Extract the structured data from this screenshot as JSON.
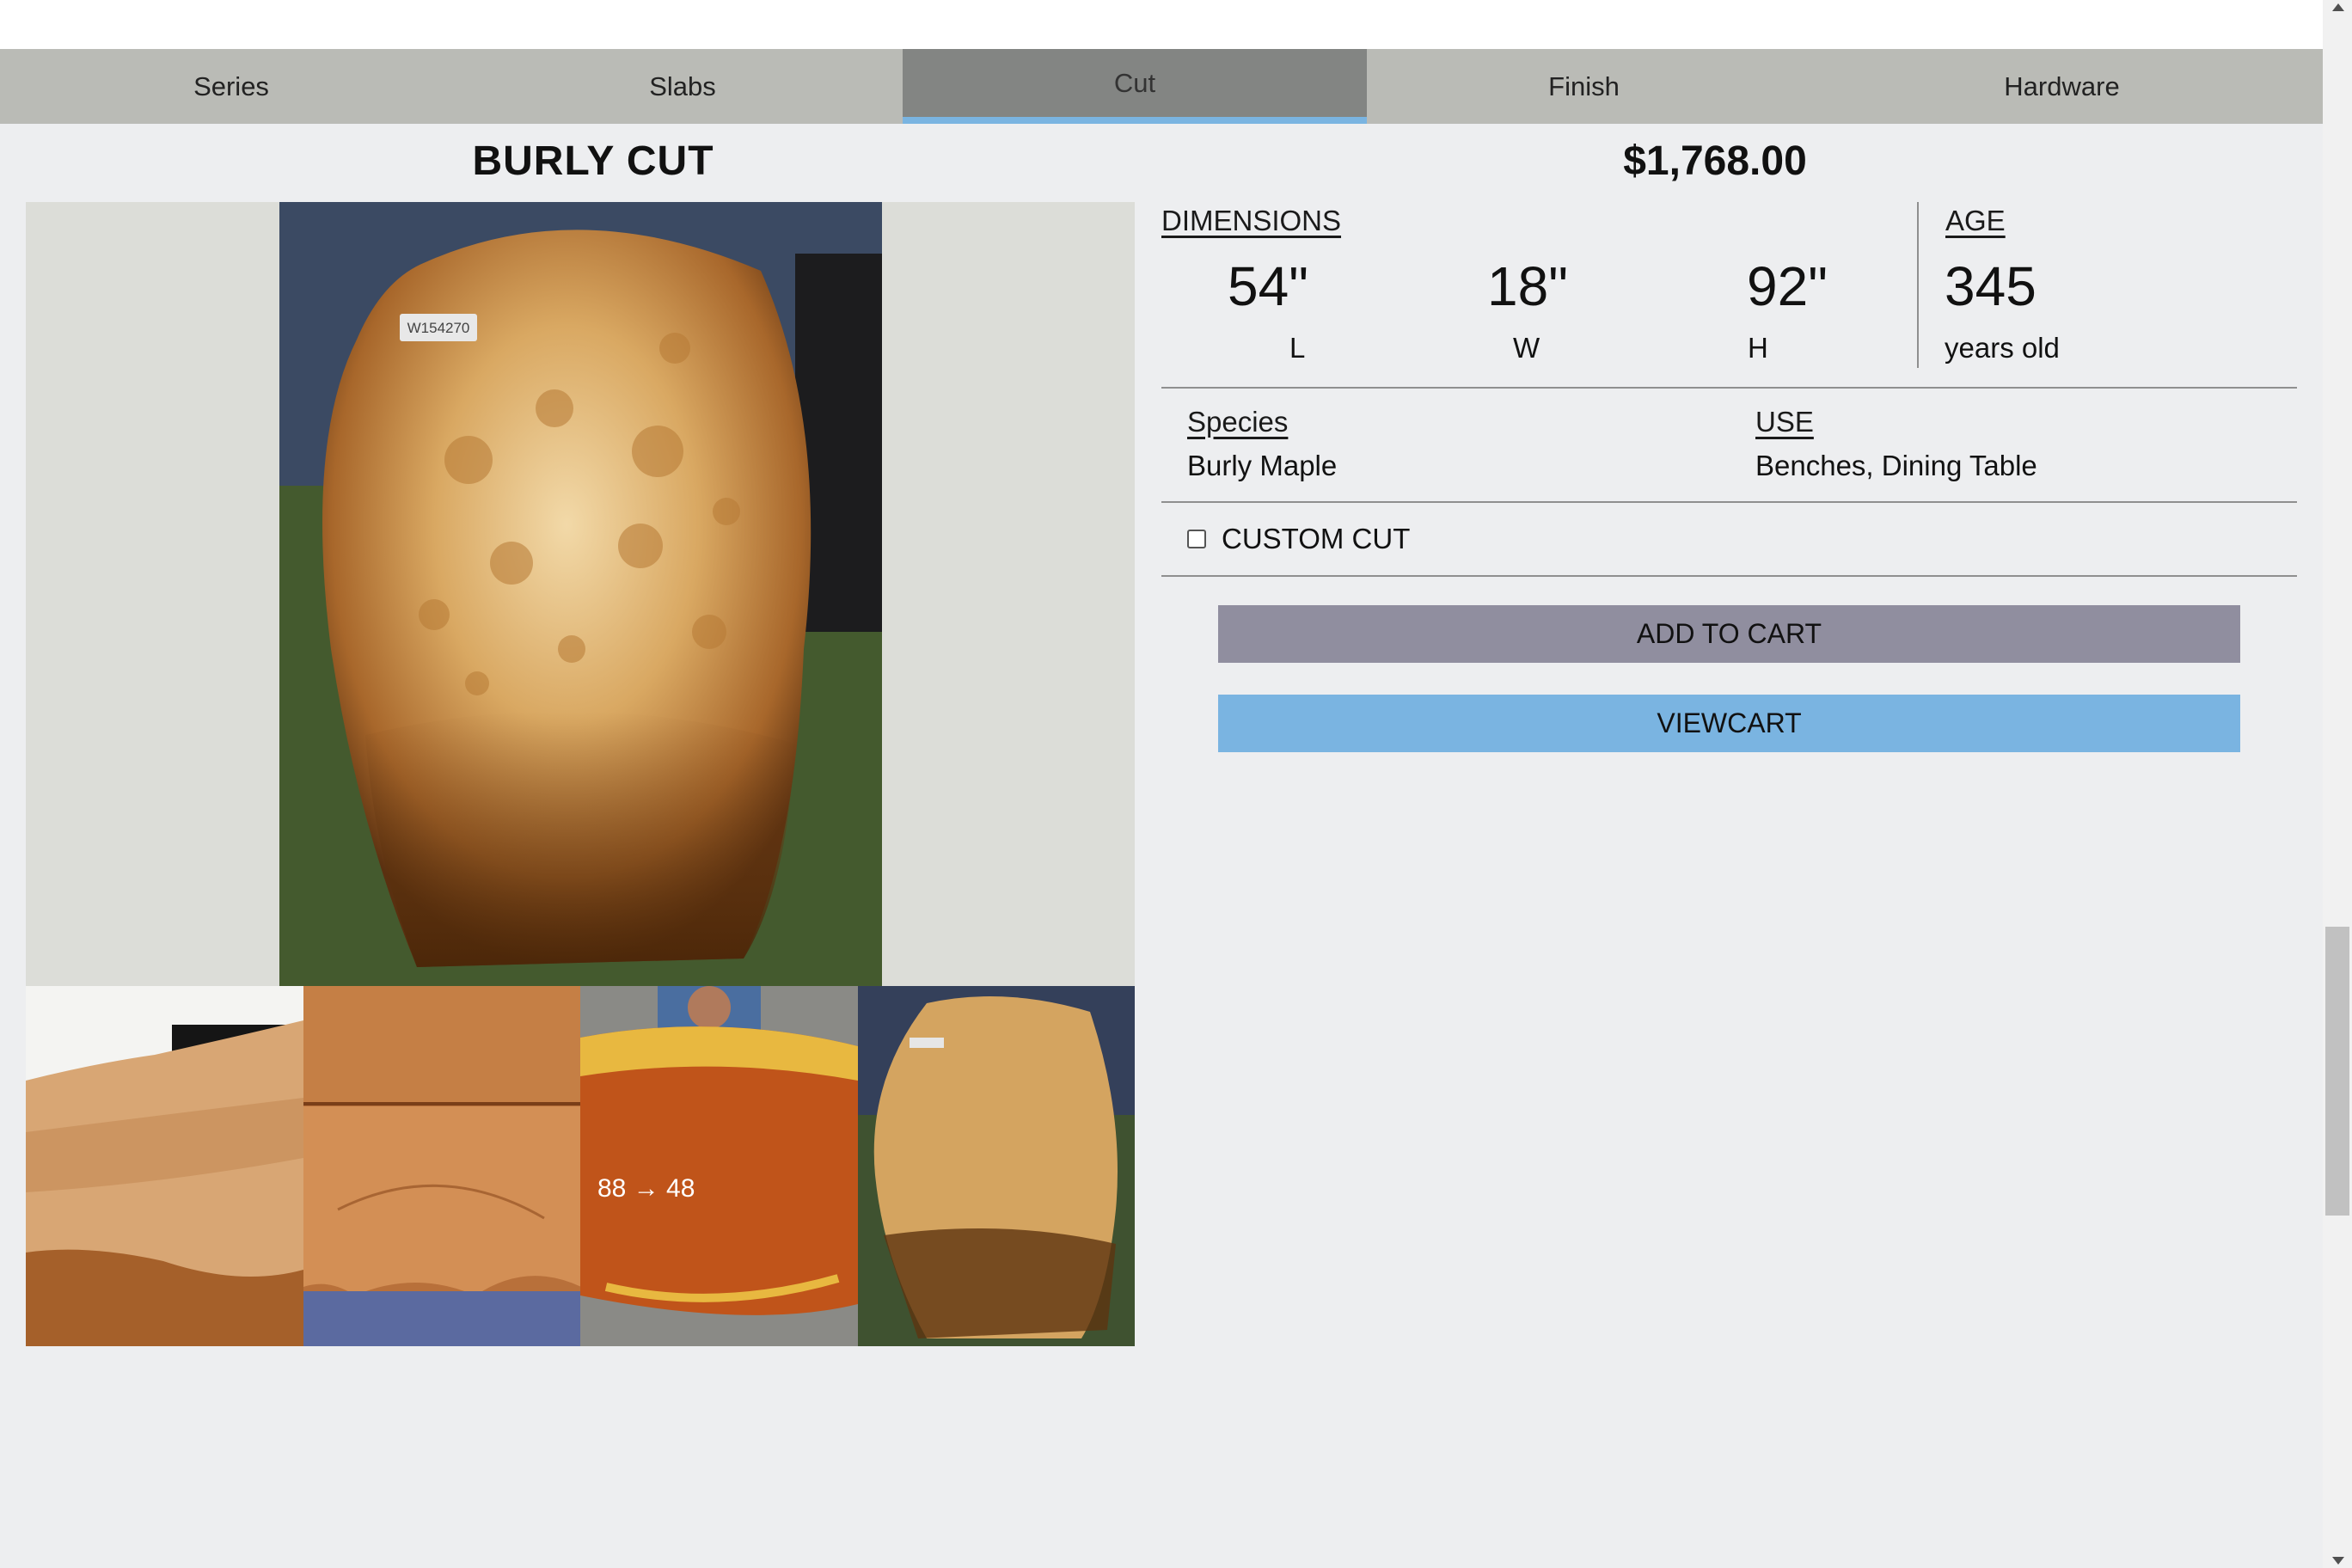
{
  "nav": {
    "tabs": [
      {
        "label": "Series"
      },
      {
        "label": "Slabs"
      },
      {
        "label": "Cut"
      },
      {
        "label": "Finish"
      },
      {
        "label": "Hardware"
      }
    ],
    "active_tab": "Cut"
  },
  "product": {
    "title": "BURLY CUT",
    "price": "$1,768.00",
    "dimensions": {
      "heading": "DIMENSIONS",
      "length": "54\"",
      "length_unit": "L",
      "width": "18\"",
      "width_unit": "W",
      "height": "92\"",
      "height_unit": "H"
    },
    "age": {
      "heading": "AGE",
      "value": "345",
      "unit": "years old"
    },
    "species": {
      "heading": "Species",
      "value": "Burly Maple"
    },
    "use": {
      "heading": "USE",
      "value": "Benches, Dining Table"
    },
    "main_photo_tag": "W154270"
  },
  "custom_cut": {
    "label": "CUSTOM CUT",
    "checked": false
  },
  "buttons": {
    "add_to_cart": "ADD TO CART",
    "view_cart": "VIEWCART"
  },
  "gallery": {
    "thumb_count": 4,
    "thumb_3_marks": "88 → 48"
  },
  "colors": {
    "nav_bg": "#babbb6",
    "nav_active_bg": "#838583",
    "nav_active_underline": "#7ab4e1",
    "add_to_cart_bg": "#908e9f",
    "view_cart_bg": "#7ab4e1",
    "page_bg": "#edeef0"
  }
}
